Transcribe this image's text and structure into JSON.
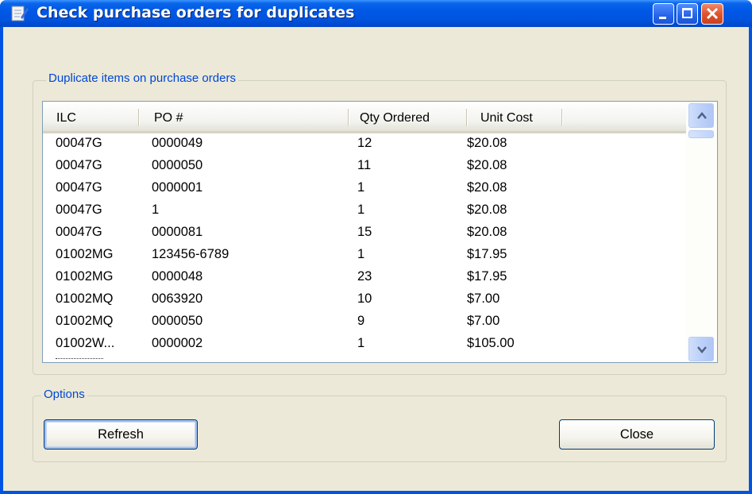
{
  "window": {
    "title": "Check purchase orders for duplicates",
    "icon": "app-document-icon",
    "controls": {
      "minimize": "minimize-icon",
      "maximize": "maximize-icon",
      "close": "close-icon"
    }
  },
  "duplicates_group": {
    "label": "Duplicate items on purchase orders",
    "columns": [
      "ILC",
      "PO #",
      "Qty Ordered",
      "Unit Cost"
    ],
    "rows": [
      {
        "ilc": "00047G",
        "po": "0000049",
        "qty": "12",
        "cost": "$20.08"
      },
      {
        "ilc": "00047G",
        "po": "0000050",
        "qty": "11",
        "cost": "$20.08"
      },
      {
        "ilc": "00047G",
        "po": "0000001",
        "qty": "1",
        "cost": "$20.08"
      },
      {
        "ilc": "00047G",
        "po": "1",
        "qty": "1",
        "cost": "$20.08"
      },
      {
        "ilc": "00047G",
        "po": "0000081",
        "qty": "15",
        "cost": "$20.08"
      },
      {
        "ilc": "01002MG",
        "po": "123456-6789",
        "qty": "1",
        "cost": "$17.95"
      },
      {
        "ilc": "01002MG",
        "po": "0000048",
        "qty": "23",
        "cost": "$17.95"
      },
      {
        "ilc": "01002MQ",
        "po": "0063920",
        "qty": "10",
        "cost": "$7.00"
      },
      {
        "ilc": "01002MQ",
        "po": "0000050",
        "qty": "9",
        "cost": "$7.00"
      },
      {
        "ilc": "01002W...",
        "po": "0000002",
        "qty": "1",
        "cost": "$105.00"
      }
    ],
    "scrollbar": {
      "up_icon": "scroll-up-arrow-icon",
      "down_icon": "scroll-down-arrow-icon"
    }
  },
  "options_group": {
    "label": "Options",
    "refresh_label": "Refresh",
    "close_label": "Close"
  },
  "colors": {
    "titlebar": "#0058e6",
    "dialog_bg": "#ece9d8",
    "group_label": "#0046d5",
    "close_button": "#e0542e"
  }
}
